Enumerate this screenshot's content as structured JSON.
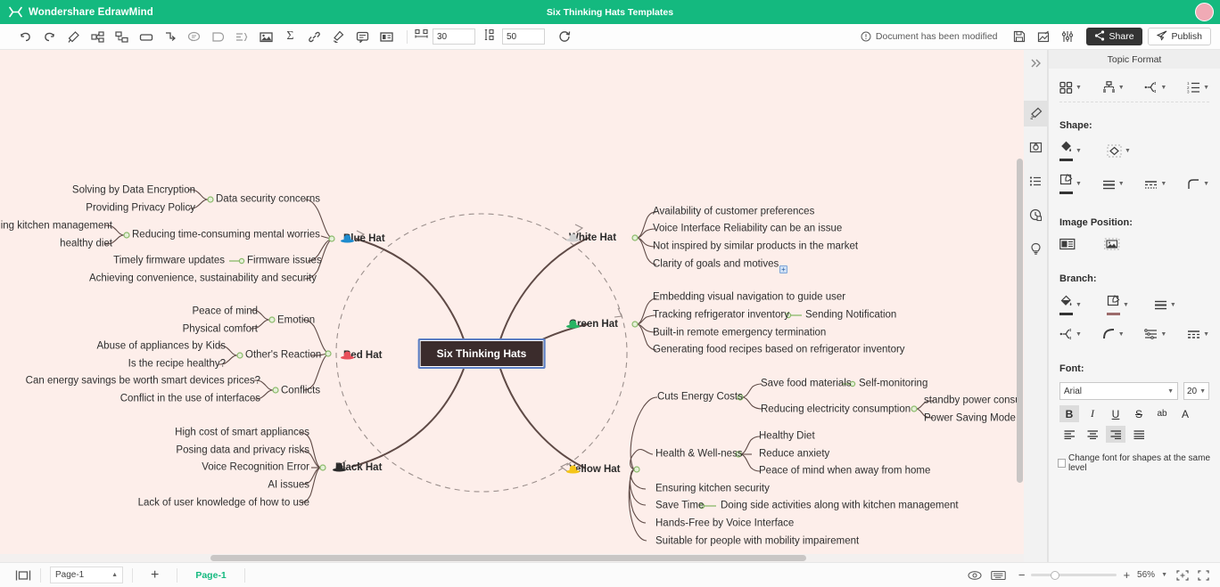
{
  "titlebar": {
    "app_name": "Wondershare EdrawMind",
    "document_title": "Six Thinking Hats Templates",
    "logo_icon": "edrawmind-logo-icon",
    "avatar_icon": "user-avatar"
  },
  "toolbar": {
    "left_tools": [
      {
        "name": "undo-icon",
        "title": "Undo"
      },
      {
        "name": "redo-icon",
        "title": "Redo"
      },
      {
        "name": "format-painter-icon",
        "title": "Format Painter"
      },
      {
        "name": "subtopic-icon",
        "title": "Subtopic"
      },
      {
        "name": "topic-icon",
        "title": "Topic"
      },
      {
        "name": "relationship-box-icon",
        "title": "Box"
      },
      {
        "name": "relationship-line-icon",
        "title": "Relationship"
      },
      {
        "name": "comment-icon",
        "title": "Comment"
      },
      {
        "name": "callout-icon",
        "title": "Callout"
      },
      {
        "name": "outline-icon",
        "title": "Outline"
      },
      {
        "name": "image-icon",
        "title": "Image"
      },
      {
        "name": "formula-icon",
        "title": "Formula"
      },
      {
        "name": "link-icon",
        "title": "Hyperlink"
      },
      {
        "name": "highlighter-icon",
        "title": "Highlight"
      },
      {
        "name": "note-icon",
        "title": "Note"
      },
      {
        "name": "card-icon",
        "title": "Card"
      }
    ],
    "spacing": {
      "horizontal_icon": "horizontal-spacing-icon",
      "horizontal_value": "30",
      "vertical_icon": "vertical-spacing-icon",
      "vertical_value": "50",
      "refresh_icon": "refresh-layout-icon"
    },
    "status_message": "Document has been modified",
    "status_icon": "info-circle-icon",
    "right_tools": [
      {
        "name": "save-icon",
        "title": "Save"
      },
      {
        "name": "export-icon",
        "title": "Export"
      },
      {
        "name": "settings-sliders-icon",
        "title": "Settings"
      }
    ],
    "share_label": "Share",
    "share_icon": "share-nodes-icon",
    "publish_label": "Publish",
    "publish_icon": "publish-plane-icon"
  },
  "canvas": {
    "background_color": "#fdeeea",
    "central_topic": "Six Thinking Hats",
    "central_fill": "#3b2c2c",
    "selection_color": "#5b7ec4",
    "branches": [
      {
        "name": "Blue Hat",
        "color": "#1e8bcd",
        "side": "left",
        "children": [
          {
            "label": "Data security concerns",
            "children": [
              "Solving by Data Encryption",
              "Providing Privacy Policy"
            ]
          },
          {
            "label": "Reducing time-consuming mental worries",
            "children": [
              "ing kitchen management",
              "healthy diet"
            ]
          },
          {
            "label": "Firmware issues",
            "children": [
              "Timely firmware updates"
            ]
          },
          {
            "label": "Achieving convenience, sustainability and security",
            "children": []
          }
        ]
      },
      {
        "name": "Red Hat",
        "color": "#e8505b",
        "side": "left",
        "children": [
          {
            "label": "Emotion",
            "children": [
              "Peace of mind",
              "Physical comfort"
            ]
          },
          {
            "label": "Other's Reaction",
            "children": [
              "Abuse of appliances by Kids",
              "Is the recipe healthy?"
            ]
          },
          {
            "label": "Conflicts",
            "children": [
              "Can energy savings be worth smart devices prices?",
              "Conflict in the use of interfaces"
            ]
          }
        ]
      },
      {
        "name": "Black Hat",
        "color": "#2b2b2b",
        "side": "left",
        "children": [
          {
            "label": "High cost of smart appliances",
            "children": []
          },
          {
            "label": "Posing data and privacy risks",
            "children": []
          },
          {
            "label": "Voice Recognition Error",
            "children": []
          },
          {
            "label": "AI issues",
            "children": []
          },
          {
            "label": "Lack of user knowledge of how to use",
            "children": []
          }
        ]
      },
      {
        "name": "White Hat",
        "color": "#cfcfcf",
        "side": "right",
        "children": [
          {
            "label": "Availability of customer preferences",
            "children": []
          },
          {
            "label": "Voice Interface Reliability can be an issue",
            "children": []
          },
          {
            "label": "Not inspired by similar products in the market",
            "children": []
          },
          {
            "label": "Clarity of goals and motives",
            "children": [],
            "expand_badge": "+"
          }
        ]
      },
      {
        "name": "Green Hat",
        "color": "#28b463",
        "side": "right",
        "children": [
          {
            "label": "Embedding visual navigation to guide user",
            "children": []
          },
          {
            "label": "Tracking refrigerator inventory",
            "children": [
              "Sending Notification"
            ]
          },
          {
            "label": "Built-in remote emergency termination",
            "children": []
          },
          {
            "label": "Generating food recipes based on refrigerator inventory",
            "children": []
          }
        ]
      },
      {
        "name": "Yellow Hat",
        "color": "#f5c518",
        "side": "right",
        "children": [
          {
            "label": "Cuts Energy Costs",
            "children": [
              "Save food materials",
              "Reducing electricity consumption"
            ]
          },
          {
            "label": "Self-monitoring",
            "children": []
          },
          {
            "label": "standby power consu",
            "children": []
          },
          {
            "label": "Power Saving Mode",
            "children": []
          },
          {
            "label": "Health & Well-ness",
            "children": [
              "Healthy Diet",
              "Reduce anxiety",
              "Peace of mind when away from home"
            ]
          },
          {
            "label": "Ensuring kitchen security",
            "children": []
          },
          {
            "label": "Save Time",
            "children": [
              "Doing side activities along with kitchen management"
            ]
          },
          {
            "label": "Hands-Free by Voice Interface",
            "children": []
          },
          {
            "label": "Suitable for people with mobility impairement",
            "children": []
          }
        ]
      }
    ]
  },
  "rail": {
    "collapse_icon": "collapse-panel-icon",
    "items": [
      {
        "name": "style-paint-icon",
        "active": true
      },
      {
        "name": "image-frame-icon",
        "active": false
      },
      {
        "name": "outline-list-icon",
        "active": false
      },
      {
        "name": "history-clock-icon",
        "active": false
      },
      {
        "name": "idea-bulb-icon",
        "active": false
      }
    ]
  },
  "panel": {
    "title": "Topic Format",
    "layout_tools": [
      {
        "name": "layout-grid-icon"
      },
      {
        "name": "structure-tree-icon"
      },
      {
        "name": "branch-shape-icon"
      },
      {
        "name": "numbering-list-icon"
      }
    ],
    "shape_label": "Shape:",
    "shape_tools_row1": [
      {
        "name": "fill-color-icon"
      },
      {
        "name": "shape-style-icon"
      }
    ],
    "shape_tools_row2": [
      {
        "name": "border-color-icon"
      },
      {
        "name": "border-weight-icon"
      },
      {
        "name": "border-dash-icon"
      },
      {
        "name": "corner-radius-icon"
      }
    ],
    "image_position_label": "Image Position:",
    "image_position_tools": [
      {
        "name": "image-left-icon"
      },
      {
        "name": "image-fill-icon"
      }
    ],
    "branch_label": "Branch:",
    "branch_tools_row1": [
      {
        "name": "branch-fill-icon"
      },
      {
        "name": "branch-color-icon"
      },
      {
        "name": "branch-weight-icon"
      }
    ],
    "branch_tools_row2": [
      {
        "name": "branch-shape-icon"
      },
      {
        "name": "branch-curve-icon"
      },
      {
        "name": "branch-taper-icon"
      },
      {
        "name": "branch-dash-icon"
      }
    ],
    "font_label": "Font:",
    "font_family": "Arial",
    "font_size": "20",
    "font_styles": [
      {
        "name": "bold-button",
        "glyph": "B",
        "active": true
      },
      {
        "name": "italic-button",
        "glyph": "I",
        "active": false
      },
      {
        "name": "underline-button",
        "glyph": "U",
        "active": false
      },
      {
        "name": "strikethrough-button",
        "glyph": "S",
        "active": false
      },
      {
        "name": "text-case-button",
        "glyph": "ab",
        "active": false
      },
      {
        "name": "font-color-button",
        "glyph": "A",
        "active": false
      }
    ],
    "align_buttons": [
      {
        "name": "align-left-button",
        "active": false
      },
      {
        "name": "align-center-button",
        "active": false
      },
      {
        "name": "align-right-button",
        "active": true
      },
      {
        "name": "align-justify-button",
        "active": false
      }
    ],
    "checkbox_label": "Change font for shapes at the same level",
    "checkbox_checked": false
  },
  "status": {
    "view_icon": "page-view-icon",
    "page_select": "Page-1",
    "add_page_icon": "+",
    "active_page_tab": "Page-1",
    "eye_icon": "presentation-eye-icon",
    "keyboard_icon": "keyboard-icon",
    "zoom_minus": "−",
    "zoom_plus": "+",
    "zoom_level": "56%",
    "fit_icon": "fit-page-icon",
    "fullscreen_icon": "fullscreen-icon"
  }
}
